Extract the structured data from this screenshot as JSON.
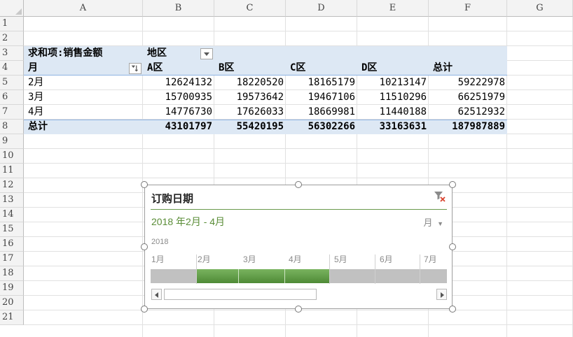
{
  "columns": [
    "A",
    "B",
    "C",
    "D",
    "E",
    "F",
    "G"
  ],
  "rows": [
    "1",
    "2",
    "3",
    "4",
    "5",
    "6",
    "7",
    "8",
    "9",
    "10",
    "11",
    "12",
    "13",
    "14",
    "15",
    "16",
    "17",
    "18",
    "19",
    "20",
    "21"
  ],
  "pivot": {
    "value_field": "求和项:销售金额",
    "column_field": "地区",
    "row_field": "月",
    "col_headers": [
      "A区",
      "B区",
      "C区",
      "D区",
      "总计"
    ],
    "data_rows": [
      {
        "label": "2月",
        "values": [
          "12624132",
          "18220520",
          "18165179",
          "10213147",
          "59222978"
        ]
      },
      {
        "label": "3月",
        "values": [
          "15700935",
          "19573642",
          "19467106",
          "11510296",
          "66251979"
        ]
      },
      {
        "label": "4月",
        "values": [
          "14776730",
          "17626033",
          "18669981",
          "11440188",
          "62512932"
        ]
      }
    ],
    "total_row": {
      "label": "总计",
      "values": [
        "43101797",
        "55420195",
        "56302266",
        "33163631",
        "187987889"
      ]
    }
  },
  "timeline": {
    "title": "订购日期",
    "range_label": "2018 年2月 - 4月",
    "level_label": "月",
    "year_label": "2018",
    "months": [
      "1月",
      "2月",
      "3月",
      "4月",
      "5月",
      "6月",
      "7月"
    ],
    "selected_start_index": 1,
    "selected_end_index": 3
  },
  "icons": {
    "clear_filter": "clear-filter-icon",
    "dropdown": "chevron-down-icon"
  },
  "colors": {
    "pivot_band": "#dde8f4",
    "selection": "#6aa84f",
    "timeline_text": "#5a8d37"
  }
}
